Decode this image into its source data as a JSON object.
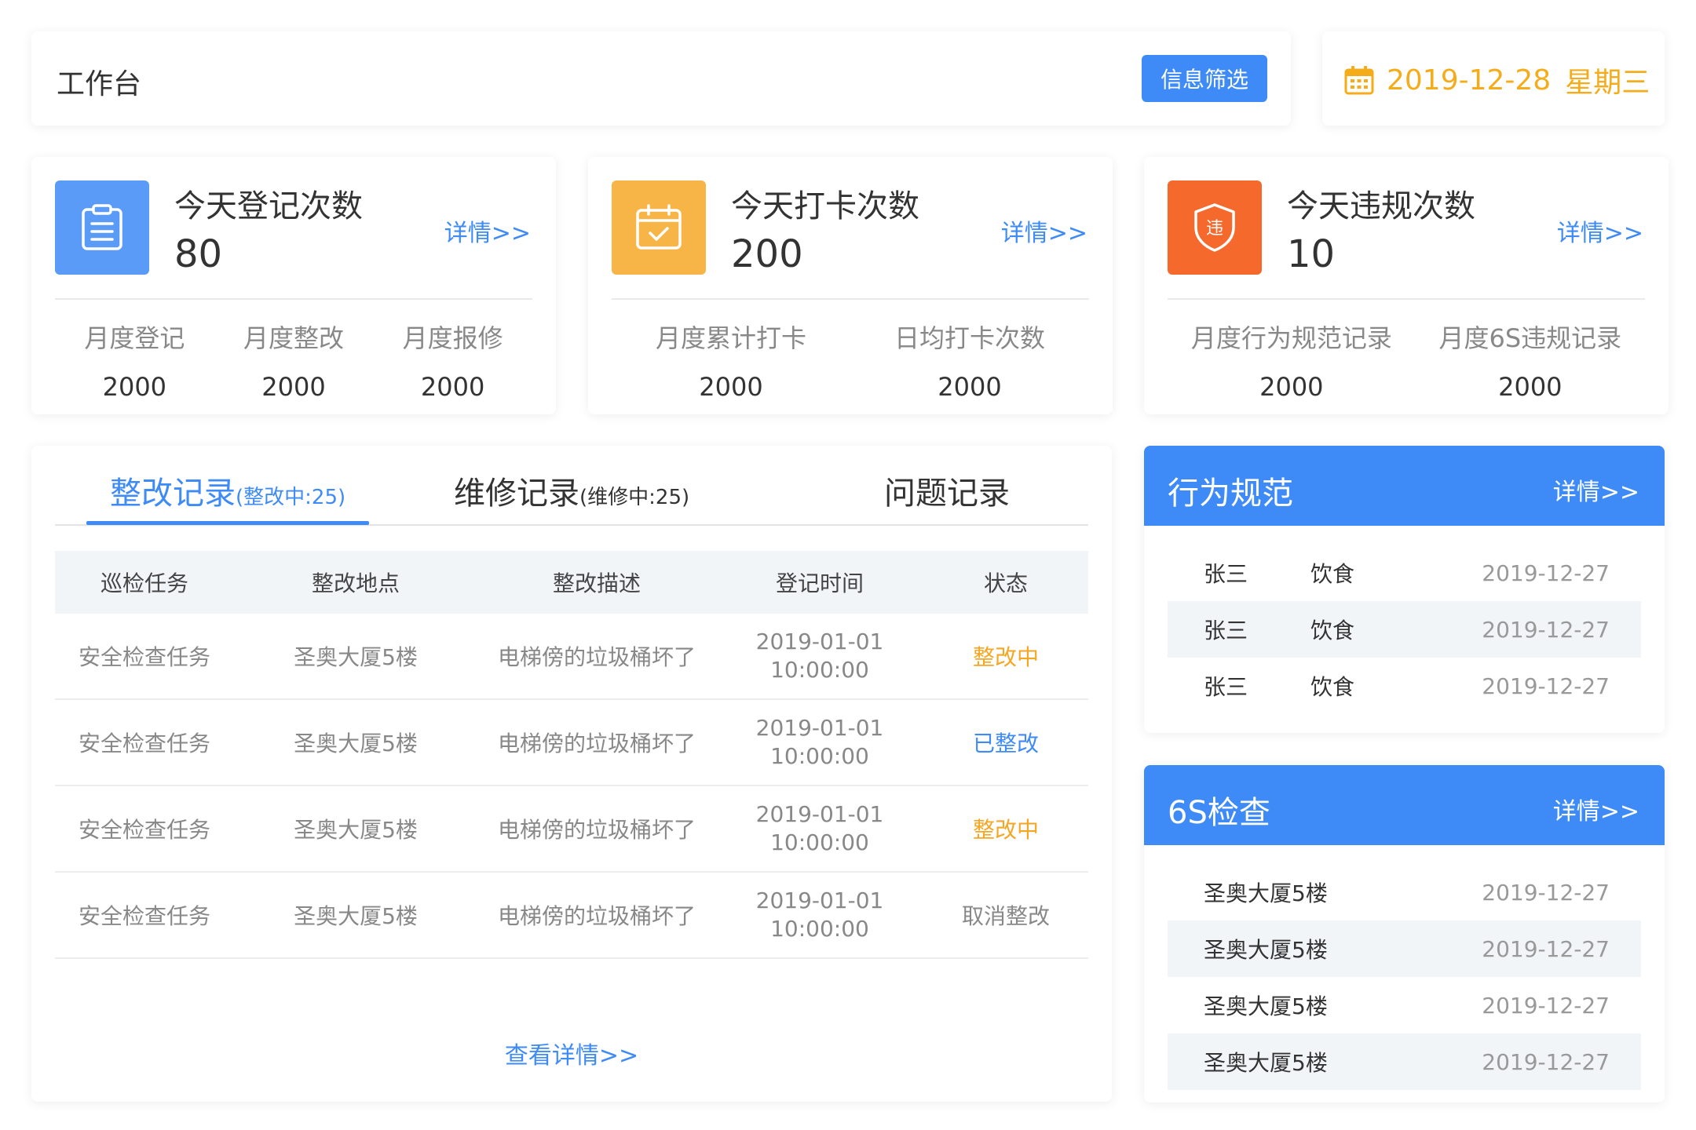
{
  "header": {
    "title": "工作台",
    "filter_label": "信息筛选"
  },
  "date": {
    "date": "2019-12-28",
    "weekday": "星期三",
    "icon": "calendar-icon",
    "color": "#F5AC1A"
  },
  "stats": [
    {
      "title": "今天登记次数",
      "value": "80",
      "detail": "详情>>",
      "icon": "clipboard-icon",
      "color": "#5B9BF8",
      "subs": [
        {
          "label": "月度登记",
          "value": "2000"
        },
        {
          "label": "月度整改",
          "value": "2000"
        },
        {
          "label": "月度报修",
          "value": "2000"
        }
      ]
    },
    {
      "title": "今天打卡次数",
      "value": "200",
      "detail": "详情>>",
      "icon": "calendar-check-icon",
      "color": "#F7B548",
      "subs": [
        {
          "label": "月度累计打卡",
          "value": "2000"
        },
        {
          "label": "日均打卡次数",
          "value": "2000"
        }
      ]
    },
    {
      "title": "今天违规次数",
      "value": "10",
      "detail": "详情>>",
      "icon": "shield-violation-icon",
      "icon_text": "违",
      "color": "#F5692D",
      "subs": [
        {
          "label": "月度行为规范记录",
          "value": "2000"
        },
        {
          "label": "月度6S违规记录",
          "value": "2000"
        }
      ]
    }
  ],
  "records": {
    "tabs": [
      {
        "label": "整改记录",
        "count": "(整改中:25)"
      },
      {
        "label": "维修记录",
        "count": "(维修中:25)"
      },
      {
        "label": "问题记录",
        "count": ""
      }
    ],
    "columns": [
      "巡检任务",
      "整改地点",
      "整改描述",
      "登记时间",
      "状态"
    ],
    "rows": [
      {
        "task": "安全检查任务",
        "place": "圣奥大厦5楼",
        "desc": "电梯傍的垃圾桶坏了",
        "date": "2019-01-01",
        "time": "10:00:00",
        "status": "整改中"
      },
      {
        "task": "安全检查任务",
        "place": "圣奥大厦5楼",
        "desc": "电梯傍的垃圾桶坏了",
        "date": "2019-01-01",
        "time": "10:00:00",
        "status": "已整改"
      },
      {
        "task": "安全检查任务",
        "place": "圣奥大厦5楼",
        "desc": "电梯傍的垃圾桶坏了",
        "date": "2019-01-01",
        "time": "10:00:00",
        "status": "整改中"
      },
      {
        "task": "安全检查任务",
        "place": "圣奥大厦5楼",
        "desc": "电梯傍的垃圾桶坏了",
        "date": "2019-01-01",
        "time": "10:00:00",
        "status": "取消整改"
      }
    ],
    "more": "查看详情>>"
  },
  "behavior": {
    "title": "行为规范",
    "link": "详情>>",
    "rows": [
      {
        "name": "张三",
        "category": "饮食",
        "date": "2019-12-27"
      },
      {
        "name": "张三",
        "category": "饮食",
        "date": "2019-12-27"
      },
      {
        "name": "张三",
        "category": "饮食",
        "date": "2019-12-27"
      }
    ]
  },
  "inspection": {
    "title": "6S检查",
    "link": "详情>>",
    "rows": [
      {
        "place": "圣奥大厦5楼",
        "date": "2019-12-27"
      },
      {
        "place": "圣奥大厦5楼",
        "date": "2019-12-27"
      },
      {
        "place": "圣奥大厦5楼",
        "date": "2019-12-27"
      },
      {
        "place": "圣奥大厦5楼",
        "date": "2019-12-27"
      }
    ]
  },
  "colors": {
    "accent": "#3E8BF7",
    "pending": "#F5A623",
    "done": "#3E8BF7",
    "cancelled": "#888888"
  }
}
